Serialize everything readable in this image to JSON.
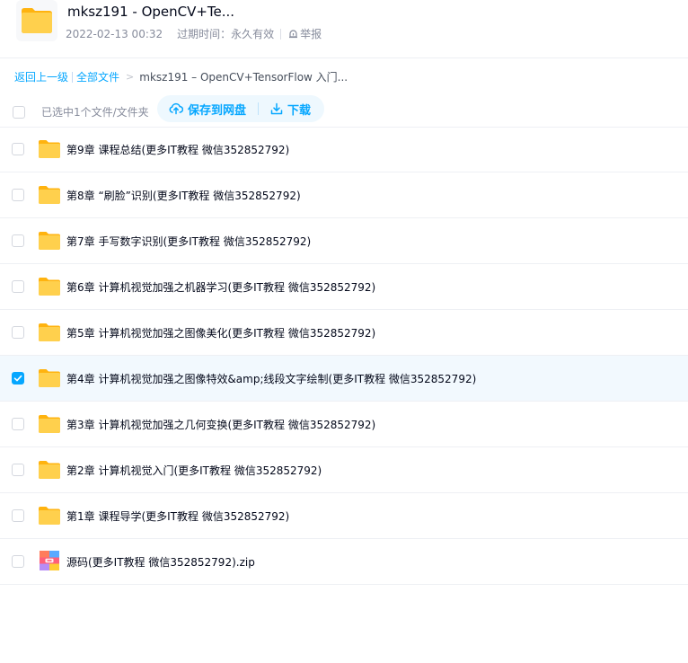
{
  "header": {
    "title": "mksz191 - OpenCV+Te...",
    "date": "2022-02-13 00:32",
    "expiry_label": "过期时间：",
    "expiry_value": "永久有效",
    "report_label": "举报"
  },
  "breadcrumb": {
    "back": "返回上一级",
    "all_files": "全部文件",
    "arrow": ">",
    "current": "mksz191 – OpenCV+TensorFlow 入门..."
  },
  "toolbar": {
    "selected_info": "已选中1个文件/文件夹",
    "save_label": "保存到网盘",
    "download_label": "下载"
  },
  "files": [
    {
      "name": "第9章 课程总结(更多IT教程 微信352852792)",
      "type": "folder",
      "checked": false
    },
    {
      "name": "第8章 “刷脸”识别(更多IT教程 微信352852792)",
      "type": "folder",
      "checked": false
    },
    {
      "name": "第7章 手写数字识别(更多IT教程 微信352852792)",
      "type": "folder",
      "checked": false
    },
    {
      "name": "第6章 计算机视觉加强之机器学习(更多IT教程 微信352852792)",
      "type": "folder",
      "checked": false
    },
    {
      "name": "第5章 计算机视觉加强之图像美化(更多IT教程 微信352852792)",
      "type": "folder",
      "checked": false
    },
    {
      "name": "第4章 计算机视觉加强之图像特效&amp;线段文字绘制(更多IT教程 微信352852792)",
      "type": "folder",
      "checked": true
    },
    {
      "name": "第3章 计算机视觉加强之几何变换(更多IT教程 微信352852792)",
      "type": "folder",
      "checked": false
    },
    {
      "name": "第2章 计算机视觉入门(更多IT教程 微信352852792)",
      "type": "folder",
      "checked": false
    },
    {
      "name": "第1章 课程导学(更多IT教程 微信352852792)",
      "type": "folder",
      "checked": false
    },
    {
      "name": "源码(更多IT教程 微信352852792).zip",
      "type": "zip",
      "checked": false
    }
  ],
  "colors": {
    "accent": "#06a7ff",
    "folder": "#ffc53d",
    "selected_row": "#f2f9fe"
  }
}
